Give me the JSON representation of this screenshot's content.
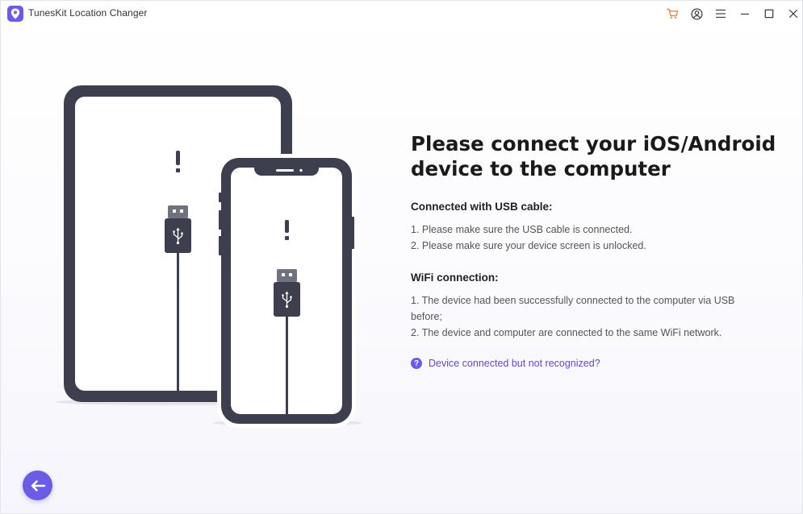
{
  "app": {
    "title": "TunesKit Location Changer"
  },
  "titlebar": {
    "icons": [
      "cart-icon",
      "account-icon",
      "menu-icon",
      "minimize-icon",
      "maximize-icon",
      "close-icon"
    ]
  },
  "main": {
    "headline_line1": "Please connect your iOS/Android",
    "headline_line2": "device to the computer",
    "usb": {
      "title": "Connected with USB cable:",
      "steps": [
        "1. Please make sure the USB cable is connected.",
        "2. Please make sure your device screen is unlocked."
      ]
    },
    "wifi": {
      "title": "WiFi connection:",
      "steps": [
        "1. The device had been successfully connected to the computer via USB",
        "before;",
        "2. The device and computer are connected to the same WiFi network."
      ]
    },
    "help_link": "Device connected but not recognized?"
  },
  "colors": {
    "accent": "#6b5ce7",
    "device_dark": "#3d3f4f",
    "cart": "#f0883c"
  }
}
